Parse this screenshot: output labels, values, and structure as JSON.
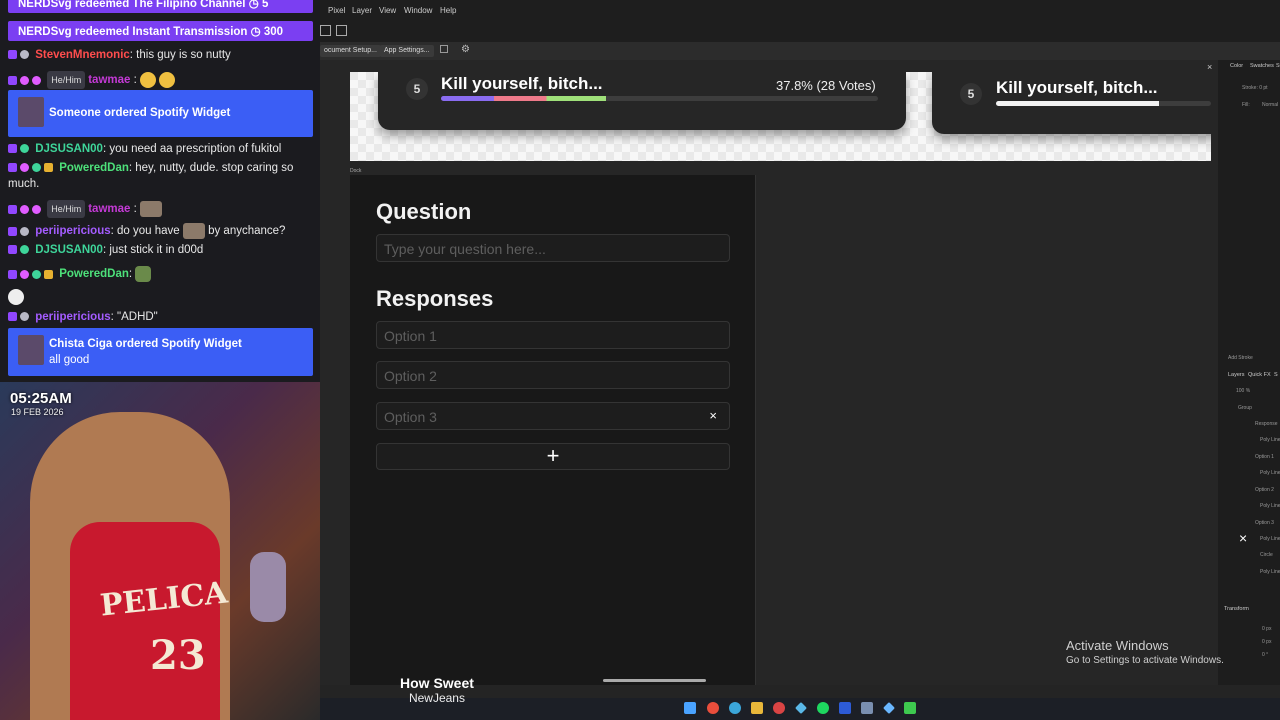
{
  "chat": {
    "redeems": [
      {
        "user": "NERDSvg",
        "text": "redeemed The Filipino Channel",
        "cost": "5"
      },
      {
        "user": "NERDSvg",
        "text": "redeemed Instant Transmission",
        "cost": "300"
      }
    ],
    "messages": [
      {
        "user": "StevenMnemonic",
        "user_color": "#ff4d4d",
        "text": ": this guy is so nutty"
      },
      {
        "pronoun": "He/Him",
        "user": "tawmae",
        "user_color": "#c43ad6",
        "text": ""
      },
      {
        "user": "DJSUSAN00",
        "user_color": "#3ed59a",
        "text": ": you need aa prescription of fukitol"
      },
      {
        "user": "PoweredDan",
        "user_color": "#4de07a",
        "text": ": hey, nutty, dude. stop caring so much."
      },
      {
        "pronoun": "He/Him",
        "user": "tawmae",
        "user_color": "#c43ad6",
        "text": ""
      },
      {
        "user": "periipericious",
        "user_color": "#a45cff",
        "text": ": do you have",
        "text2": "by anychance?"
      },
      {
        "user": "DJSUSAN00",
        "user_color": "#3ed59a",
        "text": ": just stick it in d00d"
      },
      {
        "user": "PoweredDan",
        "user_color": "#4de07a",
        "text": ":"
      },
      {
        "user": "periipericious",
        "user_color": "#a45cff",
        "text": ": \"ADHD\""
      }
    ],
    "spotify_alerts": [
      {
        "title": "Someone ordered Spotify Widget",
        "sub": ""
      },
      {
        "title": "Chista Ciga ordered Spotify Widget",
        "sub": "all good"
      }
    ]
  },
  "cam": {
    "time": "05:25AM",
    "date": "19 FEB 2026",
    "jersey_text": "PELICA",
    "jersey_number": "23"
  },
  "app": {
    "menu": [
      "Pixel",
      "Layer",
      "View",
      "Window",
      "Help"
    ],
    "context_buttons": [
      "ocument Setup...",
      "App Settings..."
    ],
    "panel_tabs": [
      "Color",
      "Swatches",
      "St"
    ],
    "stroke_label": "Stroke: 0 pt",
    "fill_label": "Fill:",
    "blend_label": "Normal",
    "add_stroke": "Add Stroke",
    "layers_tabs": [
      "Layers",
      "Quick FX",
      "S"
    ],
    "opacity": "100 %",
    "layers": [
      "Group",
      "Response",
      "Poly Line",
      "Option 1",
      "Poly Line",
      "Option 2",
      "Poly Line",
      "Option 3",
      "Poly Line",
      "Circle",
      "Poly Line"
    ],
    "transform_tab": "Transform",
    "transform_values": [
      "0 px",
      "0 px",
      "0 °"
    ],
    "dock_label": "Dock"
  },
  "poll_cards": [
    {
      "num": "5",
      "title": "Kill yourself, bitch...",
      "result": "37.8% (28 Votes)",
      "fill_pct": 37.8
    },
    {
      "num": "5",
      "title": "Kill yourself, bitch...",
      "result": "",
      "fill_pct": 76
    }
  ],
  "editor": {
    "question_heading": "Question",
    "question_placeholder": "Type your question here...",
    "responses_heading": "Responses",
    "options": [
      "Option 1",
      "Option 2",
      "Option 3"
    ],
    "delete_symbol": "×",
    "add_symbol": "+"
  },
  "watermark": {
    "line1": "Activate Windows",
    "line2": "Go to Settings to activate Windows."
  },
  "now_playing": {
    "song": "How Sweet",
    "artist": "NewJeans"
  }
}
